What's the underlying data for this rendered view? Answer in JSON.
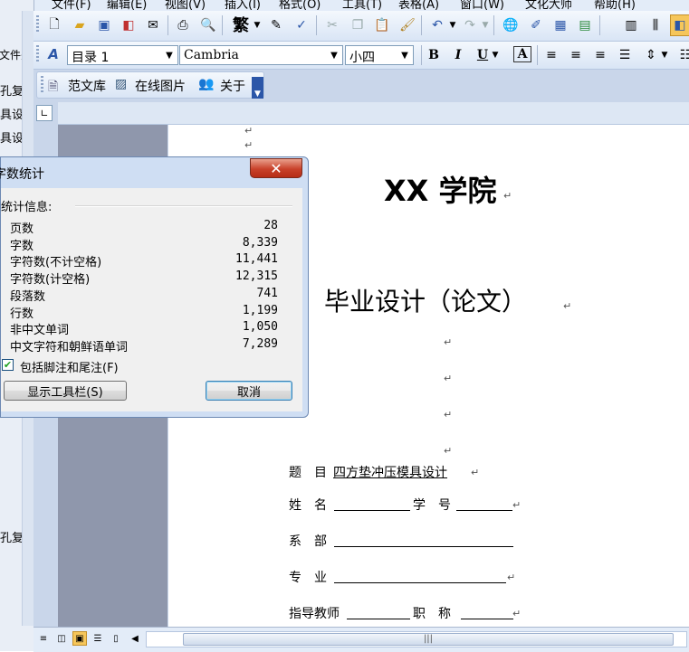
{
  "menubar": {
    "items": [
      "文件(F)",
      "编辑(E)",
      "视图(V)",
      "插入(I)",
      "格式(O)",
      "工具(T)",
      "表格(A)",
      "窗口(W)",
      "文化大师",
      "帮助(H)"
    ]
  },
  "left_pane": {
    "texts": [
      "文件夹",
      "孔复",
      "具设",
      "具设",
      "孔复"
    ]
  },
  "format_toolbar": {
    "style_value": "目录 1",
    "font_value": "Cambria",
    "size_value": "小四",
    "bold": "B",
    "italic": "I",
    "underline": "U",
    "font_color": "A"
  },
  "extra_toolbar": {
    "template_library": "范文库",
    "online_images": "在线图片",
    "about": "关于"
  },
  "standard_toolbar": {
    "traditional": "繁"
  },
  "document": {
    "college": "XX 学院",
    "thesis_title": "毕业设计（论文）",
    "topic_label": "题　目",
    "topic_value": "四方垫冲压模具设计",
    "name_label": "姓　名",
    "student_id_label": "学　号",
    "department_label": "系　部",
    "major_label": "专　业",
    "advisor_label": "指导教师",
    "position_label": "职　称",
    "para_mark": "↵"
  },
  "word_count_dialog": {
    "title": "字数统计",
    "section_header": "统计信息:",
    "rows": [
      {
        "label": "页数",
        "value": "28"
      },
      {
        "label": "字数",
        "value": "8,339"
      },
      {
        "label": "字符数(不计空格)",
        "value": "11,441"
      },
      {
        "label": "字符数(计空格)",
        "value": "12,315"
      },
      {
        "label": "段落数",
        "value": "741"
      },
      {
        "label": "行数",
        "value": "1,199"
      },
      {
        "label": "非中文单词",
        "value": "1,050"
      },
      {
        "label": "中文字符和朝鲜语单词",
        "value": "7,289"
      }
    ],
    "include_notes_label": "包括脚注和尾注(F)",
    "include_notes_checked": true,
    "show_toolbar_button": "显示工具栏(S)",
    "close_button": "取消"
  },
  "statusbar": {
    "scroll_grip": "|||"
  },
  "colors": {
    "toolbar_bg": "#d9e5f5",
    "page_margin": "#8f97ac",
    "dialog_frame": "#cfdef3",
    "close_red": "#c8412a"
  }
}
